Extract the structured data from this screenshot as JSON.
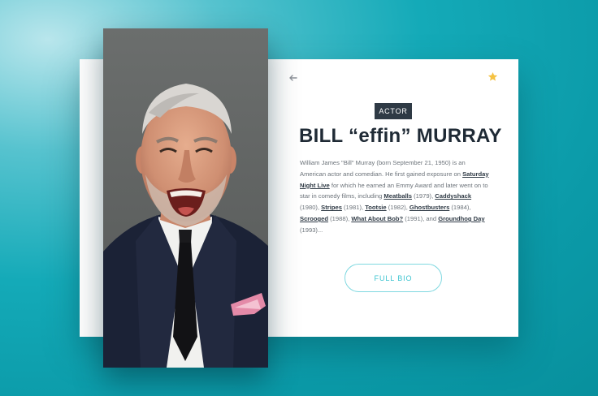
{
  "profile": {
    "badge": "ACTOR",
    "name": "BILL “effin” MURRAY",
    "bio": {
      "t1": "William James \"Bill\" Murray (born September 21, 1950) is an American actor and comedian. He first gained exposure on ",
      "l1": "Saturday Night Live",
      "t2": " for which he earned an Emmy Award and later went on to star in comedy films, including ",
      "l2": "Meatballs",
      "t3": " (1979), ",
      "l3": "Caddyshack",
      "t4": " (1980), ",
      "l4": "Stripes",
      "t5": " (1981), ",
      "l5": "Tootsie",
      "t6": " (1982), ",
      "l6": "Ghostbusters",
      "t7": " (1984), ",
      "l7": "Scrooged",
      "t8": " (1988), ",
      "l8": "What About Bob?",
      "t9": " (1991), and ",
      "l9": "Groundhog Day",
      "t10": " (1993)..."
    },
    "button_label": "FULL BIO"
  },
  "icons": {
    "back": "arrow-left-icon",
    "favorite": "star-icon"
  },
  "colors": {
    "background": "#0fa4b2",
    "badge_bg": "#2f3a45",
    "name": "#1f2a35",
    "button_accent": "#3cc4d0",
    "star": "#f5c242"
  }
}
